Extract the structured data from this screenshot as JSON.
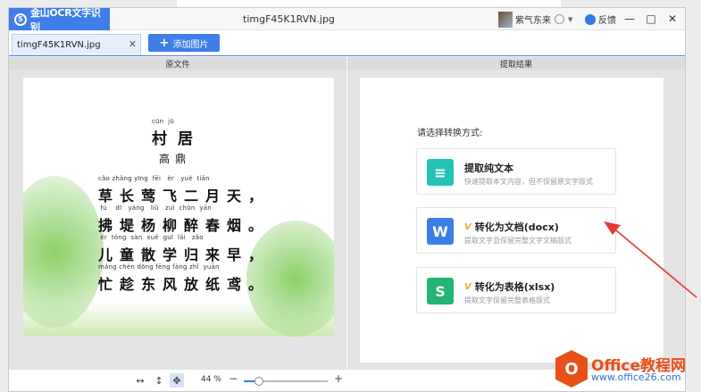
{
  "app": {
    "logo_glyph": "S",
    "name": "金山OCR文字识别",
    "brand_color": "#3f7de8"
  },
  "window": {
    "title": "timgF45K1RVN.jpg"
  },
  "user": {
    "name": "紫气东来"
  },
  "feedback": {
    "label": "反馈"
  },
  "controls": {
    "minimize": "—",
    "maximize": "□",
    "close": "✕"
  },
  "tabs": [
    {
      "label": "timgF45K1RVN.jpg"
    }
  ],
  "add_image": {
    "label": "添加图片"
  },
  "panes": {
    "source_title": "原文件",
    "result_title": "提取结果"
  },
  "poem": {
    "title_pinyin": "cūn  jū",
    "title": "村居",
    "author": "高鼎",
    "lines": [
      {
        "pinyin": "cǎo zhǎng yīng  fēi   èr   yuè  tiān",
        "text": "草长莺飞二月天，"
      },
      {
        "pinyin": " fú    dī   yáng   liǔ   zuì  chūn  yān",
        "text": "拂堤杨柳醉春烟。"
      },
      {
        "pinyin": " ér  tóng  sàn  xué  guī  lái   zǎo",
        "text": "儿童散学归来早，"
      },
      {
        "pinyin": "máng chèn dōng fēng fàng zhǐ  yuān",
        "text": "忙趁东风放纸鸢。"
      }
    ]
  },
  "result": {
    "prompt": "请选择转换方式:",
    "options": [
      {
        "icon": "text-icon",
        "glyph": "≡",
        "color": "#25c3b6",
        "vip": false,
        "title": "提取纯文本",
        "desc": "快速提取本文内容，但不保留原文字版式"
      },
      {
        "icon": "word-icon",
        "glyph": "W",
        "color": "#3b7fe6",
        "vip": true,
        "title": "转化为文档(docx)",
        "desc": "提取文字且保留完整文字文稿版式"
      },
      {
        "icon": "sheet-icon",
        "glyph": "S",
        "color": "#22b573",
        "vip": true,
        "title": "转化为表格(xlsx)",
        "desc": "提取文字保留完整表格版式"
      }
    ],
    "vip_glyph": "V"
  },
  "zoom": {
    "value": "44 %",
    "level": 0.18,
    "minus": "−",
    "plus": "+"
  },
  "tools": {
    "fit_width": "↔",
    "fit_height": "↕",
    "pan": "✥"
  },
  "watermark": {
    "logo": "O",
    "title": "Office教程网",
    "url": "www.office26.com"
  }
}
